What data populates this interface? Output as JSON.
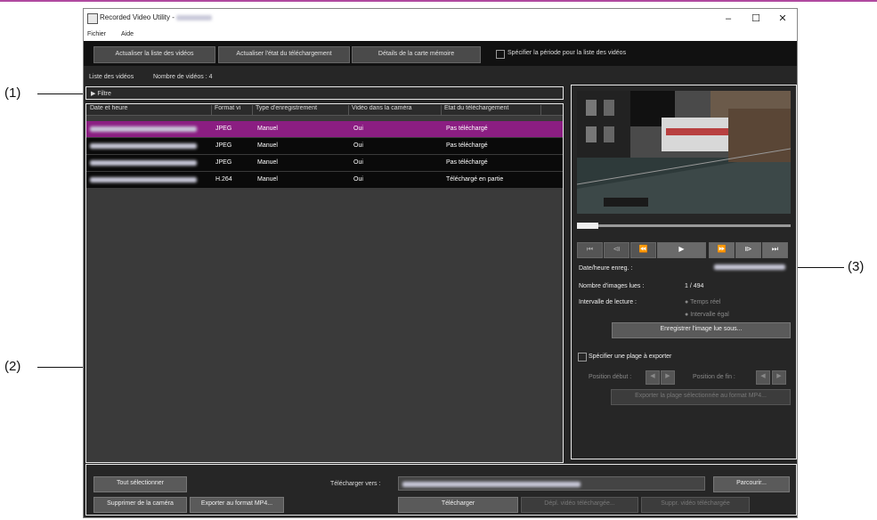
{
  "window": {
    "title": "Recorded Video Utility -",
    "menu": [
      "Fichier",
      "Aide"
    ],
    "controls": {
      "minimize": "–",
      "maximize": "☐",
      "close": "✕"
    }
  },
  "toolbar": {
    "refresh_list": "Actualiser la liste des vidéos",
    "refresh_download": "Actualiser l'état du téléchargement",
    "memory_card": "Détails de la carte mémoire",
    "period_label": "Spécifier la période pour la liste des vidéos"
  },
  "video_list": {
    "label": "Liste des vidéos",
    "count_label": "Nombre de vidéos : 4",
    "filter_label": "Filtre",
    "columns": [
      "Date et heure",
      "Format vi",
      "Type d'enregistrement",
      "Vidéo dans la caméra",
      "État du téléchargement"
    ],
    "rows": [
      {
        "format": "JPEG",
        "type": "Manuel",
        "in_camera": "Oui",
        "status": "Pas téléchargé",
        "selected": true
      },
      {
        "format": "JPEG",
        "type": "Manuel",
        "in_camera": "Oui",
        "status": "Pas téléchargé",
        "selected": false
      },
      {
        "format": "JPEG",
        "type": "Manuel",
        "in_camera": "Oui",
        "status": "Pas téléchargé",
        "selected": false
      },
      {
        "format": "H.264",
        "type": "Manuel",
        "in_camera": "Oui",
        "status": "Téléchargé en partie",
        "selected": false
      }
    ]
  },
  "player": {
    "buttons": [
      "⏮",
      "⧏",
      "⏪",
      "▶",
      "⏩",
      "⧐",
      "⏭"
    ],
    "date_label": "Date/heure enreg. :",
    "images_label": "Nombre d'images lues :",
    "images_value": "1 / 494",
    "interval_label": "Intervalle de lecture :",
    "interval_opt1": "Temps réel",
    "interval_opt2": "Intervalle égal",
    "save_image": "Enregistrer l'image lue sous...",
    "export_range_label": "Spécifier une plage à exporter",
    "start_label": "Position début :",
    "end_label": "Position de fin :",
    "export_mp4_range": "Exporter la plage sélectionnée au format MP4..."
  },
  "bottom": {
    "select_all": "Tout sélectionner",
    "delete_camera": "Supprimer de la caméra",
    "export_mp4": "Exporter au format MP4...",
    "download_to": "Télécharger vers :",
    "browse": "Parcourir...",
    "download": "Télécharger",
    "move_downloaded": "Dépl. vidéo téléchargée...",
    "delete_downloaded": "Suppr. vidéo téléchargée"
  },
  "callouts": [
    "(1)",
    "(2)",
    "(3)"
  ],
  "colors": {
    "selected_row": "#8b1e82",
    "window_bg": "#262626",
    "accent_line": "#b04aa0"
  }
}
